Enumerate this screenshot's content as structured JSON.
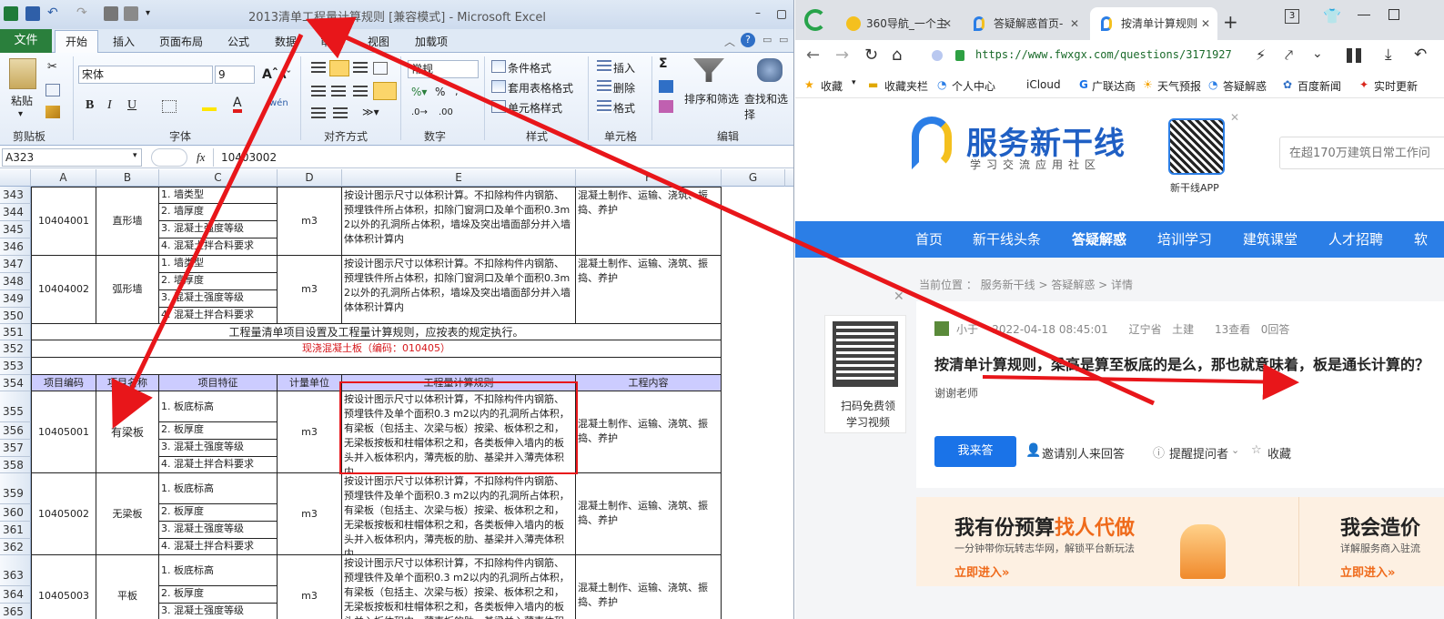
{
  "excel": {
    "title": "2013清单工程量计算规则 [兼容模式] - Microsoft Excel",
    "tabs": {
      "file": "文件",
      "home": "开始",
      "insert": "插入",
      "layout": "页面布局",
      "formula": "公式",
      "data": "数据",
      "review": "审阅",
      "view": "视图",
      "addins": "加载项"
    },
    "ribbon": {
      "paste": "粘贴",
      "clipboard": "剪贴板",
      "font_name": "宋体",
      "font_size": "9",
      "font": "字体",
      "alignment": "对齐方式",
      "number_format": "常规",
      "number": "数字",
      "cond_format": "条件格式",
      "table_format": "套用表格格式",
      "cell_style": "单元格样式",
      "styles": "样式",
      "insert": "插入",
      "delete": "删除",
      "format": "格式",
      "cells": "单元格",
      "sort_filter": "排序和筛选",
      "find_select": "查找和选择",
      "editing": "编辑",
      "bold": "B",
      "italic": "I",
      "underline": "U",
      "sigma": "Σ"
    },
    "name_box": "A323",
    "fx": "fx",
    "formula_value": "10403002",
    "columns": [
      "A",
      "B",
      "C",
      "D",
      "E",
      "F",
      "G"
    ],
    "rows": {
      "r343": "343",
      "r344": "344",
      "r345": "345",
      "r346": "346",
      "r347": "347",
      "r348": "348",
      "r349": "349",
      "r350": "350",
      "r351": "351",
      "r352": "352",
      "r353": "353",
      "r354": "354",
      "r355": "355",
      "r356": "356",
      "r357": "357",
      "r358": "358",
      "r359": "359",
      "r360": "360",
      "r361": "361",
      "r362": "362",
      "r363": "363",
      "r364": "364",
      "r365": "365"
    },
    "cells": {
      "code_10404001": "10404001",
      "name_zhixing": "直形墙",
      "feat_wall_type": "1. 墙类型",
      "feat_wall_thick": "2. 墙厚度",
      "feat_conc_grade": "3. 混凝土强度等级",
      "feat_conc_mix": "4. 混凝土拌合料要求",
      "unit_m3": "m3",
      "rule_wall": "按设计图示尺寸以体积计算。不扣除构件内钢筋、预埋铁件所占体积，扣除门窗洞口及单个面积0.3m2以外的孔洞所占体积，墙垛及突出墙面部分并入墙体体积计算内",
      "work_content": "混凝土制作、运输、浇筑、振捣、养护",
      "code_10404002": "10404002",
      "name_huxing": "弧形墙",
      "row351": "工程量清单项目设置及工程量计算规则，应按表的规定执行。",
      "row352": "现浇混凝土板（编码：010405）",
      "h_code": "项目编码",
      "h_name": "项目名称",
      "h_feat": "项目特征",
      "h_unit": "计量单位",
      "h_rule": "工程量计算规则",
      "h_work": "工程内容",
      "code_10405001": "10405001",
      "name_youliangban": "有梁板",
      "feat_slab_elev": "1. 板底标高",
      "feat_slab_thick": "2. 板厚度",
      "rule_slab": "按设计图示尺寸以体积计算，不扣除构件内钢筋、预埋铁件及单个面积0.3 m2以内的孔洞所占体积，有梁板（包括主、次梁与板）按梁、板体积之和，无梁板按板和柱帽体积之和，各类板伸入墙内的板头并入板体积内，薄壳板的肋、基梁并入薄壳体积内",
      "code_10405002": "10405002",
      "name_wuliangban": "无梁板",
      "code_10405003": "10405003",
      "name_pingban": "平板"
    }
  },
  "browser": {
    "tabs": [
      "360导航_一个主",
      "答疑解惑首页-",
      "按清单计算规则"
    ],
    "tab_count": "3",
    "url": "https://www.fwxgx.com/questions/3171927",
    "favorites": [
      "收藏",
      "收藏夹栏",
      "个人中心",
      "iCloud",
      "广联达商",
      "天气预报",
      "答疑解惑",
      "百度新闻",
      "实时更新"
    ],
    "site": {
      "logo": "服务新干线",
      "slogan": "学习交流应用社区",
      "app": "新干线APP",
      "search_placeholder": "在超170万建筑日常工作问",
      "nav": [
        "首页",
        "新干线头条",
        "答疑解惑",
        "培训学习",
        "建筑课堂",
        "人才招聘",
        "软"
      ],
      "breadcrumb": "当前位置 ： 服务新干线 > 答疑解惑 > 详情",
      "qr_caption1": "扫码免费领",
      "qr_caption2": "学习视频",
      "user": "小于",
      "date": "2022-04-18 08:45:01",
      "region": "辽宁省",
      "category": "土建",
      "views": "13查看",
      "answers": "0回答",
      "question": "按清单计算规则，梁高是算至板底的是么，那也就意味着，板是通长计算的？",
      "thanks": "谢谢老师",
      "answer_btn": "我来答",
      "invite": "邀请别人来回答",
      "remind": "提醒提问者",
      "collect": "收藏",
      "banner1_title_a": "我有份预算",
      "banner1_title_b": "找人代做",
      "banner1_sub": "一分钟带你玩转志华网，解锁平台新玩法",
      "banner1_link": "立即进入»",
      "banner2_title": "我会造价",
      "banner2_sub": "详解服务商入驻流",
      "banner2_link": "立即进入»"
    }
  },
  "colors": {
    "arrow": "#e8161a",
    "excel_green": "#2a7f3c",
    "nav_blue": "#2b7ee6",
    "link_blue": "#1a73e8"
  }
}
